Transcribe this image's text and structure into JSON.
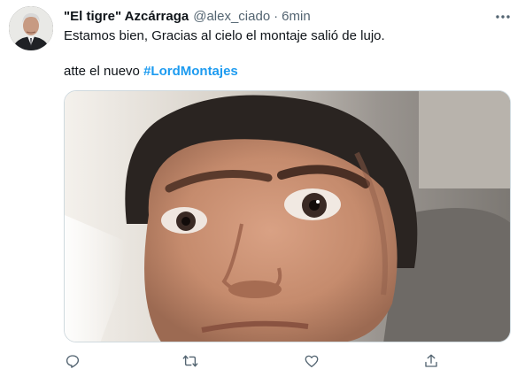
{
  "tweet": {
    "display_name": "\"El tigre\" Azcárraga",
    "handle": "@alex_ciado",
    "separator": "·",
    "time": "6min",
    "line1": "Estamos bien, Gracias al cielo el montaje salió de lujo.",
    "line2_prefix": "atte el nuevo ",
    "hashtag": "#LordMontajes"
  },
  "icons": {
    "more": "more-horizontal-icon",
    "reply": "reply-icon",
    "retweet": "retweet-icon",
    "like": "like-icon",
    "share": "share-icon"
  },
  "colors": {
    "hashtag": "#1d9bf0",
    "secondary_text": "#536471",
    "primary_text": "#0f1419"
  }
}
